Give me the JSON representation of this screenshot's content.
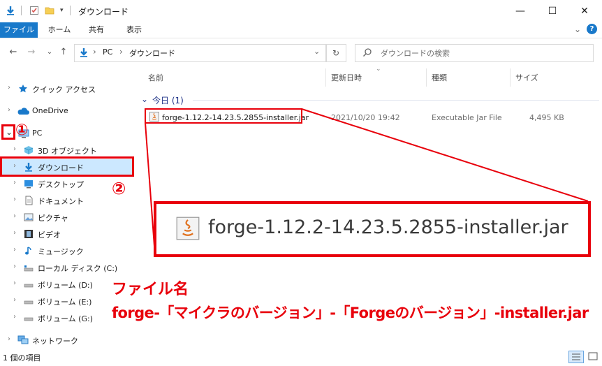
{
  "window": {
    "title": "ダウンロード",
    "minimize_glyph": "—",
    "maximize_glyph": "☐",
    "close_glyph": "✕"
  },
  "ribbon": {
    "tabs": [
      "ファイル",
      "ホーム",
      "共有",
      "表示"
    ],
    "expand_glyph": "⌄",
    "help_glyph": "?"
  },
  "address": {
    "back": "←",
    "forward": "→",
    "recent": "⌄",
    "up": "↑",
    "crumbs": [
      "PC",
      "ダウンロード"
    ],
    "separator": "›",
    "dropdown": "⌄",
    "refresh": "↻",
    "search_placeholder": "ダウンロードの検索"
  },
  "columns": {
    "name": "名前",
    "date": "更新日時",
    "type": "種類",
    "size": "サイズ"
  },
  "group": {
    "label": "今日 (1)",
    "chevron": "⌄"
  },
  "file": {
    "name": "forge-1.12.2-14.23.5.2855-installer.jar",
    "date": "2021/10/20 19:42",
    "type": "Executable Jar File",
    "size": "4,495 KB"
  },
  "nav": [
    {
      "label": "クイック アクセス",
      "icon": "star-icon",
      "chev": "›"
    },
    {
      "label": "OneDrive",
      "icon": "cloud-icon",
      "chev": "›"
    },
    {
      "label": "PC",
      "icon": "computer-icon",
      "chev": "⌄"
    },
    {
      "label": "3D オブジェクト",
      "icon": "cube-icon",
      "chev": "›"
    },
    {
      "label": "ダウンロード",
      "icon": "download-arrow-icon",
      "chev": "›"
    },
    {
      "label": "デスクトップ",
      "icon": "desktop-icon",
      "chev": "›"
    },
    {
      "label": "ドキュメント",
      "icon": "document-icon",
      "chev": "›"
    },
    {
      "label": "ピクチャ",
      "icon": "picture-icon",
      "chev": "›"
    },
    {
      "label": "ビデオ",
      "icon": "video-icon",
      "chev": "›"
    },
    {
      "label": "ミュージック",
      "icon": "music-icon",
      "chev": "›"
    },
    {
      "label": "ローカル ディスク (C:)",
      "icon": "drive-icon",
      "chev": "›"
    },
    {
      "label": "ボリューム (D:)",
      "icon": "drive-icon",
      "chev": "›"
    },
    {
      "label": "ボリューム (E:)",
      "icon": "drive-icon",
      "chev": "›"
    },
    {
      "label": "ボリューム (G:)",
      "icon": "drive-icon",
      "chev": "›"
    },
    {
      "label": "ネットワーク",
      "icon": "network-icon",
      "chev": "›"
    }
  ],
  "status": {
    "count": "1 個の項目"
  },
  "annotations": {
    "step1": "①",
    "step2": "②",
    "heading": "ファイル名",
    "pattern": "forge-「マイクラのバージョン」-「Forgeのバージョン」-installer.jar",
    "zoom_filename": "forge-1.12.2-14.23.5.2855-installer.jar"
  },
  "colors": {
    "accent": "#1979ca",
    "annotation_red": "#e8000b",
    "selection": "#cce8ff"
  }
}
